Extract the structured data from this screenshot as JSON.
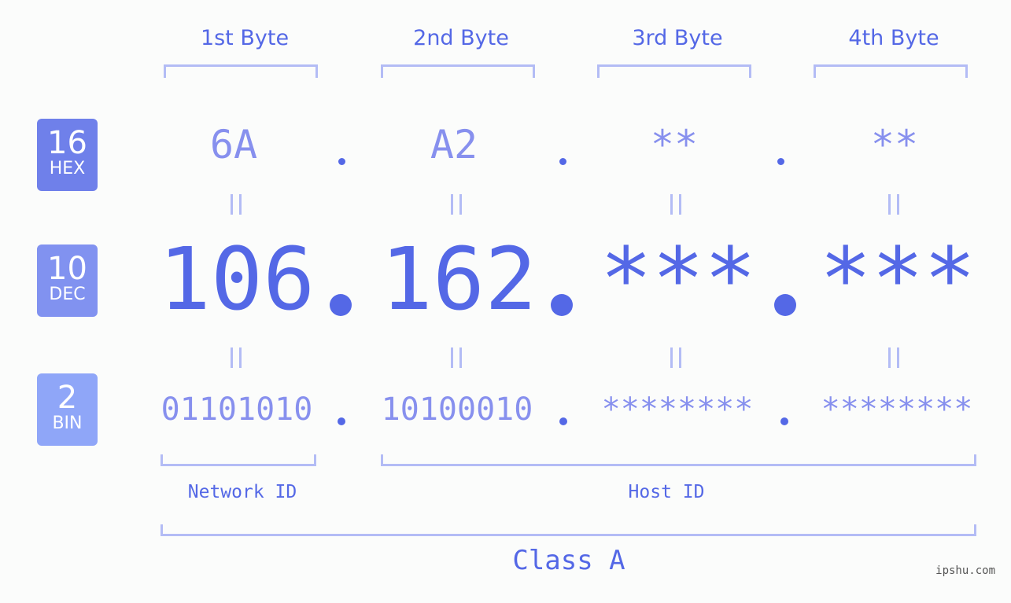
{
  "bytes": [
    {
      "label": "1st Byte",
      "hex": "6A",
      "dec": "106",
      "bin": "01101010"
    },
    {
      "label": "2nd Byte",
      "hex": "A2",
      "dec": "162",
      "bin": "10100010"
    },
    {
      "label": "3rd Byte",
      "hex": "**",
      "dec": "***",
      "bin": "********"
    },
    {
      "label": "4th Byte",
      "hex": "**",
      "dec": "***",
      "bin": "********"
    }
  ],
  "badges": {
    "hex": {
      "num": "16",
      "label": "HEX",
      "color": "#6f80ea"
    },
    "dec": {
      "num": "10",
      "label": "DEC",
      "color": "#8192f0"
    },
    "bin": {
      "num": "2",
      "label": "BIN",
      "color": "#8fa6f8"
    }
  },
  "network_id_label": "Network ID",
  "host_id_label": "Host ID",
  "class_label": "Class A",
  "watermark": "ipshu.com"
}
